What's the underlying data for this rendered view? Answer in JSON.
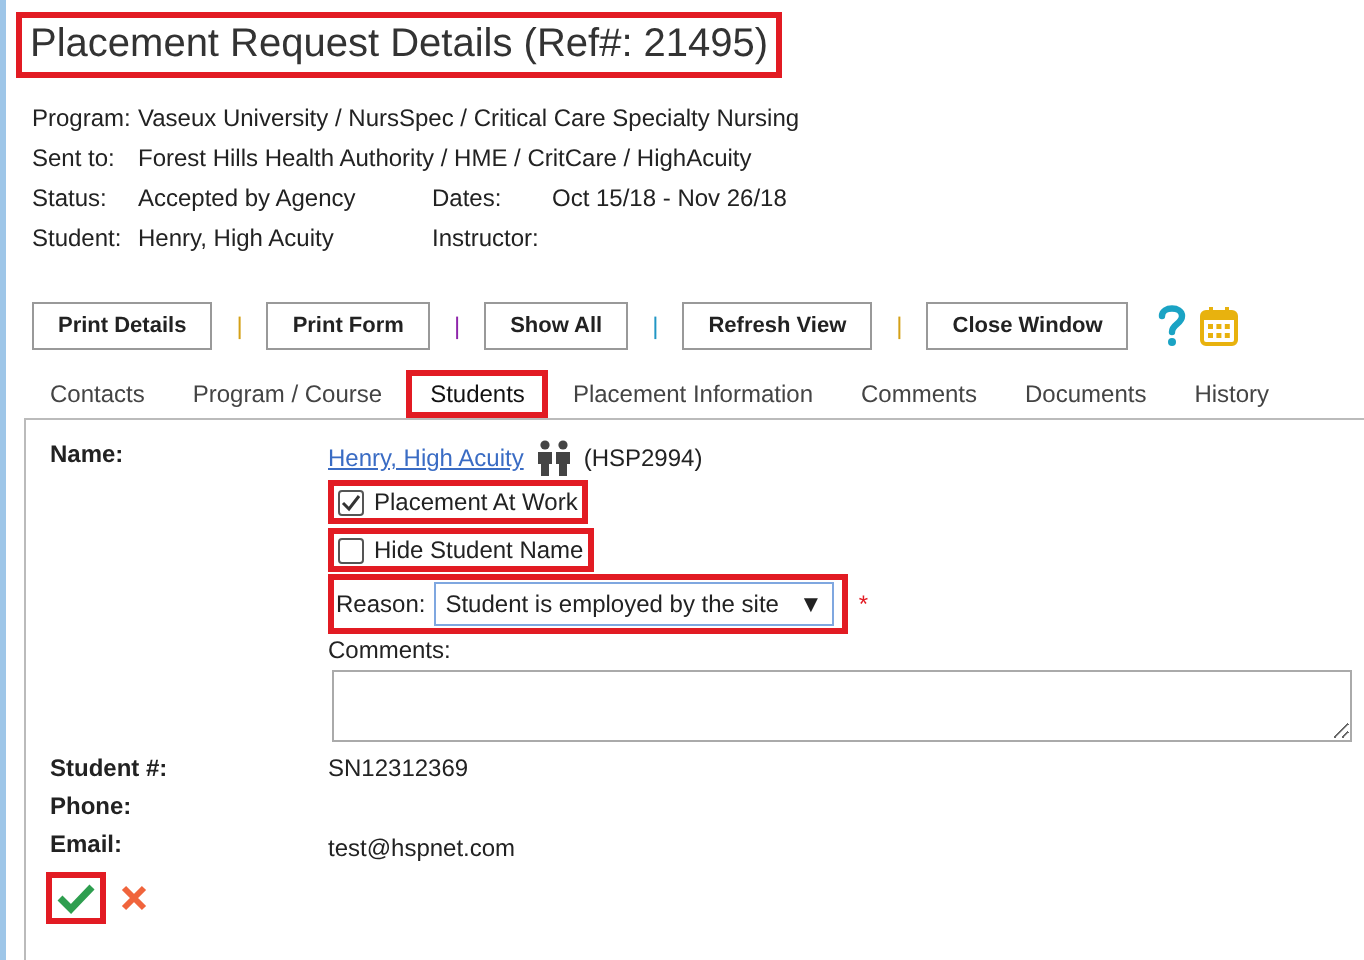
{
  "title": {
    "text": "Placement Request Details (Ref#: 21495)",
    "highlighted": true
  },
  "info": [
    {
      "label": "Program:",
      "value": "Vaseux University / NursSpec / Critical Care Specialty Nursing"
    },
    {
      "label": "Sent to:",
      "value": "Forest Hills Health Authority / HME / CritCare / HighAcuity"
    },
    {
      "label": "Status:",
      "value": "Accepted by Agency",
      "label2": "Dates:",
      "value2": "Oct 15/18 - Nov 26/18"
    },
    {
      "label": "Student:",
      "value": "Henry, High Acuity",
      "label2": "Instructor:"
    }
  ],
  "toolbar": [
    {
      "kind": "button",
      "label": "Print Details"
    },
    {
      "kind": "separator",
      "label": "|",
      "color": "#d4a017"
    },
    {
      "kind": "button",
      "label": "Print Form"
    },
    {
      "kind": "separator",
      "label": "|",
      "color": "#8e24aa"
    },
    {
      "kind": "button",
      "label": "Show All"
    },
    {
      "kind": "separator",
      "label": "|",
      "color": "#2196c4"
    },
    {
      "kind": "button",
      "label": "Refresh View"
    },
    {
      "kind": "separator",
      "label": "|",
      "color": "#d4a017"
    },
    {
      "kind": "button",
      "label": "Close Window"
    },
    {
      "kind": "help"
    },
    {
      "kind": "calendar"
    }
  ],
  "tabs": [
    {
      "label": "Contacts",
      "selected": false,
      "highlighted": false
    },
    {
      "label": "Program / Course",
      "selected": false,
      "highlighted": false
    },
    {
      "label": "Students",
      "selected": true,
      "highlighted": true
    },
    {
      "label": "Placement Information",
      "selected": false,
      "highlighted": false
    },
    {
      "label": "Comments",
      "selected": false,
      "highlighted": false
    },
    {
      "label": "Documents",
      "selected": false,
      "highlighted": false
    },
    {
      "label": "History",
      "selected": false,
      "highlighted": false
    }
  ],
  "student": {
    "name_label": "Name:",
    "name": "Henry, High Acuity",
    "id": "(HSP2994)",
    "checkboxes": [
      {
        "label": "Placement At Work",
        "checked": true,
        "highlighted": true
      },
      {
        "label": "Hide Student Name",
        "checked": false,
        "highlighted": true
      }
    ],
    "reason": {
      "label": "Reason:",
      "value": "Student is employed by the site",
      "caret": "▼",
      "required": "*",
      "highlighted": true
    },
    "comments_label": "Comments:",
    "details": [
      {
        "label": "Student #:",
        "value": "SN12312369"
      },
      {
        "label": "Phone:"
      },
      {
        "label": "Email:",
        "value": "test@hspnet.com"
      }
    ],
    "save_highlighted": true
  }
}
